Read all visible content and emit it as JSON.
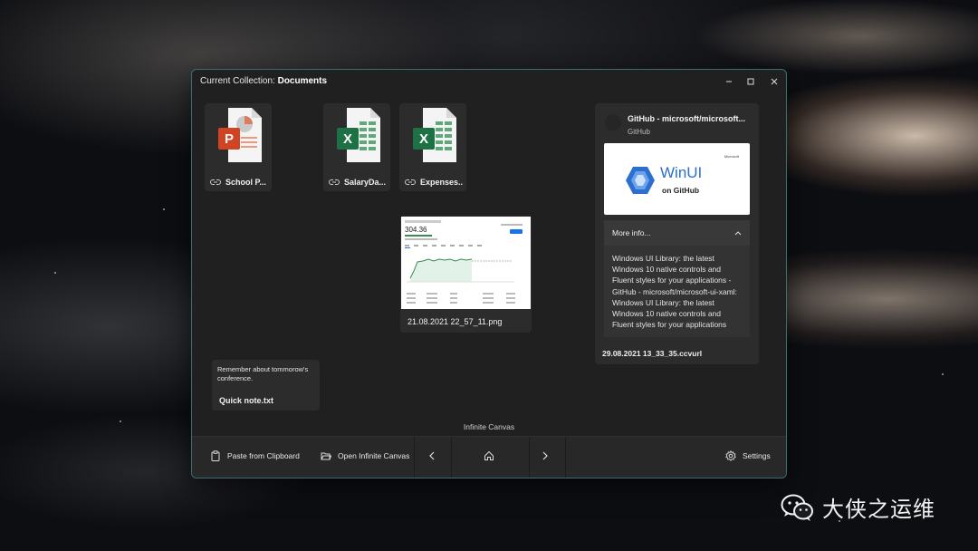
{
  "window": {
    "title_prefix": "Current Collection:",
    "collection_name": "Documents"
  },
  "files": [
    {
      "name": "School P...",
      "type": "powerpoint",
      "icon": "powerpoint-file-icon"
    },
    {
      "name": "SalaryDa...",
      "type": "excel",
      "icon": "excel-file-icon"
    },
    {
      "name": "Expenses...",
      "type": "excel",
      "icon": "excel-file-icon"
    }
  ],
  "image_item": {
    "filename": "21.08.2021 22_57_11.png",
    "thumb_price": "304.36"
  },
  "note_item": {
    "text": "Remember about tommorow's conference.",
    "filename": "Quick note.txt"
  },
  "url_item": {
    "title": "GitHub - microsoft/microsoft...",
    "site": "GitHub",
    "preview_brand": "WinUI",
    "preview_sub": "on GitHub",
    "preview_corner": "Microsoft",
    "more_info_label": "More info...",
    "description": "Windows UI Library: the latest Windows 10 native controls and Fluent styles for your applications - GitHub - microsoft/microsoft-ui-xaml: Windows UI Library: the latest Windows 10 native controls and Fluent styles for your applications",
    "filename": "29.08.2021 13_33_35.ccvurl"
  },
  "canvas_label": "Infinite Canvas",
  "bottombar": {
    "paste_label": "Paste from Clipboard",
    "open_canvas_label": "Open Infinite Canvas",
    "settings_label": "Settings"
  },
  "watermark": {
    "text": "大侠之运维"
  },
  "colors": {
    "window_bg": "#202020",
    "card_bg": "#2c2c2c",
    "window_border": "#3a6e70",
    "powerpoint": "#d04423",
    "excel": "#1e7145",
    "winui_blue": "#2c6fd0"
  }
}
